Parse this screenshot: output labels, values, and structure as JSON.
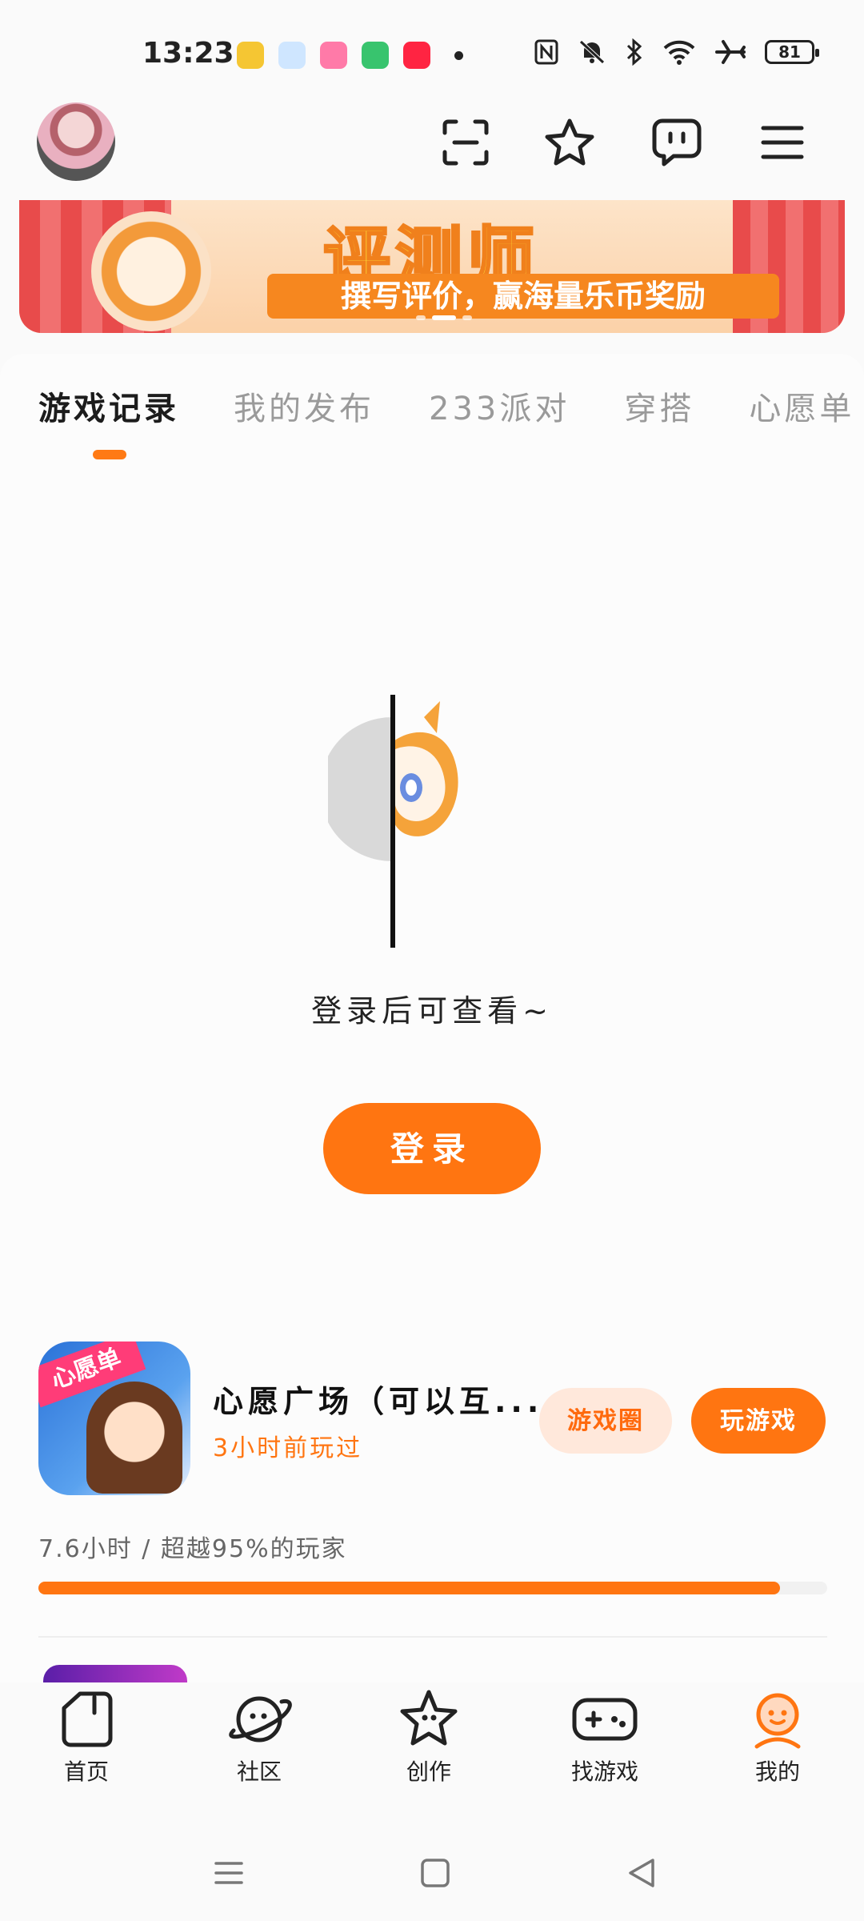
{
  "status_bar": {
    "time": "13:23",
    "battery": "81",
    "notification_icons": [
      {
        "name": "weibo-icon",
        "color": "#f5c633"
      },
      {
        "name": "feather-app-icon",
        "color": "#5aa8ff"
      },
      {
        "name": "pink-app-icon",
        "color": "#ff7aa8"
      },
      {
        "name": "video-app-icon",
        "color": "#38c46e"
      },
      {
        "name": "xiaohongshu-icon",
        "color": "#ff2442"
      }
    ]
  },
  "banner": {
    "title": "评测师",
    "subtitle": "撰写评价，赢海量乐币奖励"
  },
  "tabs": [
    {
      "label": "游戏记录",
      "active": true
    },
    {
      "label": "我的发布",
      "active": false
    },
    {
      "label": "233派对",
      "active": false
    },
    {
      "label": "穿搭",
      "active": false
    },
    {
      "label": "心愿单",
      "active": false
    }
  ],
  "empty_state": {
    "message": "登录后可查看~",
    "login_label": "登录"
  },
  "game": {
    "icon_badge": "心愿单",
    "title": "心愿广场（可以互...",
    "last_played": "3小时前玩过",
    "circle_label": "游戏圈",
    "play_label": "玩游戏",
    "playtime": "7.6小时 / 超越95%的玩家",
    "progress": 0.94
  },
  "bottom_nav": [
    {
      "label": "首页",
      "icon": "home-icon"
    },
    {
      "label": "社区",
      "icon": "planet-icon"
    },
    {
      "label": "创作",
      "icon": "star-create-icon"
    },
    {
      "label": "找游戏",
      "icon": "gamepad-icon"
    },
    {
      "label": "我的",
      "icon": "profile-icon",
      "active": true
    }
  ],
  "colors": {
    "accent": "#ff7511",
    "accent_light": "#ffe8db",
    "text": "#222222"
  }
}
